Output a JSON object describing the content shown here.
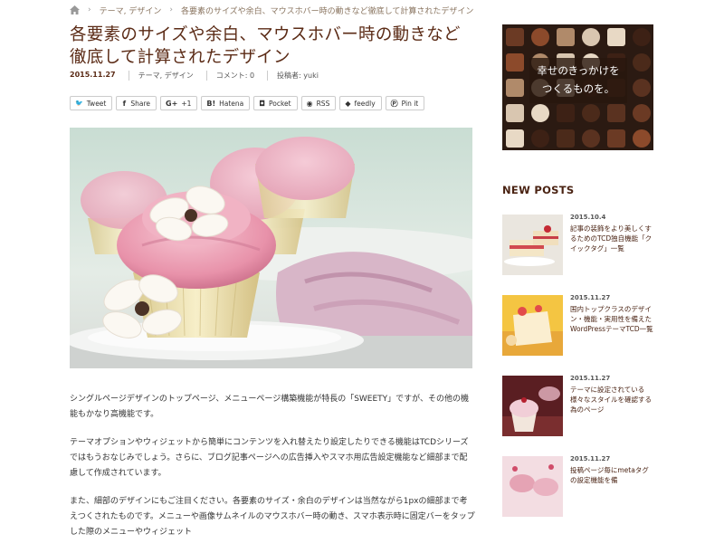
{
  "breadcrumb": {
    "category": "テーマ, デザイン",
    "current": "各要素のサイズや余白、マウスホバー時の動きなど徹底して計算されたデザイン"
  },
  "article": {
    "title": "各要素のサイズや余白、マウスホバー時の動きなど徹底して計算されたデザイン",
    "date": "2015.11.27",
    "categories": "テーマ, デザイン",
    "comments": "コメント: 0",
    "author": "投稿者: yuki",
    "paragraphs": [
      "シングルページデザインのトップページ、メニューページ構築機能が特長の「SWEETY」ですが、その他の機能もかなり高機能です。",
      "テーマオプションやウィジェットから簡単にコンテンツを入れ替えたり設定したりできる機能はTCDシリーズではもうおなじみでしょう。さらに、ブログ記事ページへの広告挿入やスマホ用広告設定機能など細部まで配慮して作成されています。",
      "また、細部のデザインにもご注目ください。各要素のサイズ・余白のデザインは当然ながら1pxの細部まで考えつくされたものです。メニューや画像サムネイルのマウスホバー時の動き、スマホ表示時に固定バーをタップした際のメニューやウィジェット"
    ]
  },
  "share": [
    {
      "label": "Tweet",
      "icon": "bird-icon",
      "glyph": "🐦"
    },
    {
      "label": "Share",
      "icon": "facebook-icon",
      "glyph": "f"
    },
    {
      "label": "+1",
      "icon": "google-plus-icon",
      "glyph": "G+"
    },
    {
      "label": "Hatena",
      "icon": "hatena-icon",
      "glyph": "B!"
    },
    {
      "label": "Pocket",
      "icon": "pocket-icon",
      "glyph": "◘"
    },
    {
      "label": "RSS",
      "icon": "rss-icon",
      "glyph": "◉"
    },
    {
      "label": "feedly",
      "icon": "feedly-icon",
      "glyph": "◆"
    },
    {
      "label": "Pin it",
      "icon": "pinterest-icon",
      "glyph": "Ⓟ"
    }
  ],
  "sidebar": {
    "ad": {
      "line1": "幸せのきっかけを",
      "line2": "つくるものを。"
    },
    "new_posts_heading": "NEW POSTS",
    "posts": [
      {
        "date": "2015.10.4",
        "title": "記事の装飾をより美しくするためのTCD独自機能「クイックタグ」一覧"
      },
      {
        "date": "2015.11.27",
        "title": "国内トップクラスのデザイン・機能・実用性を備えたWordPressテーマTCD一覧"
      },
      {
        "date": "2015.11.27",
        "title": "テーマに設定されている様々なスタイルを確認する為のページ"
      },
      {
        "date": "2015.11.27",
        "title": "投稿ページ毎にmetaタグの設定機能を備"
      }
    ]
  },
  "colors": {
    "title": "#5b2b16",
    "accent": "#4a2313",
    "border": "#cccccc"
  }
}
